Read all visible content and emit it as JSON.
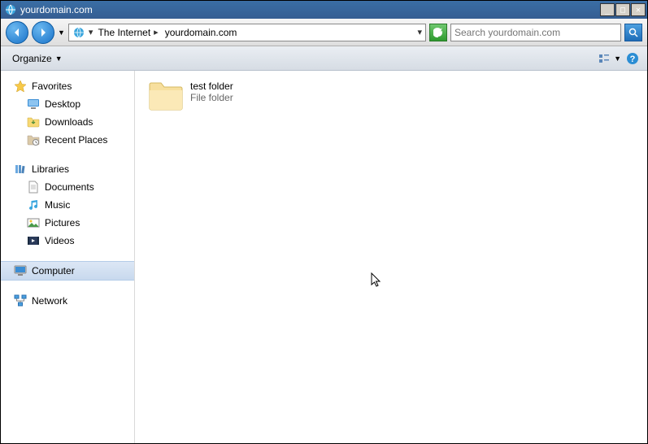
{
  "window": {
    "title": "yourdomain.com"
  },
  "nav": {
    "breadcrumb_root": "The Internet",
    "breadcrumb_leaf": "yourdomain.com"
  },
  "search": {
    "placeholder": "Search yourdomain.com"
  },
  "toolbar": {
    "organize": "Organize"
  },
  "tree": {
    "favorites": {
      "label": "Favorites"
    },
    "favorites_items": {
      "desktop": "Desktop",
      "downloads": "Downloads",
      "recent": "Recent Places"
    },
    "libraries": {
      "label": "Libraries"
    },
    "libraries_items": {
      "documents": "Documents",
      "music": "Music",
      "pictures": "Pictures",
      "videos": "Videos"
    },
    "computer": "Computer",
    "network": "Network"
  },
  "items": {
    "folder0": {
      "name": "test folder",
      "type": "File folder"
    }
  }
}
